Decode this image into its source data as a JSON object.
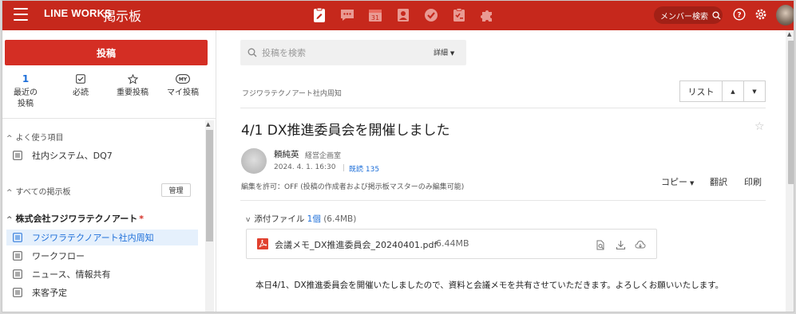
{
  "topbar": {
    "brand": "LINE WORKS",
    "app_name": "掲示板",
    "app_icons": [
      "board-icon",
      "chat-icon",
      "calendar-icon",
      "contacts-icon",
      "task-icon",
      "survey-icon",
      "puzzle-icon"
    ],
    "calendar_day": "31",
    "member_search": "メンバー検索",
    "accent": "#c6281c"
  },
  "sidebar": {
    "post_button": "投稿",
    "quick": [
      {
        "count": "1",
        "label": "最近の\n投稿"
      },
      {
        "label": "必読"
      },
      {
        "label": "重要投稿"
      },
      {
        "icon_text": "MY",
        "label": "マイ投稿"
      }
    ],
    "favorites_header": "よく使う項目",
    "favorites": [
      "社内システム、DQ7"
    ],
    "all_boards_header": "すべての掲示板",
    "manage_button": "管理",
    "company": "株式会社フジワラテクノアート",
    "company_mark": "*",
    "boards": [
      "フジワラテクノアート社内周知",
      "ワークフロー",
      "ニュース、情報共有",
      "来客予定"
    ],
    "active_board_color": "#1e6fd9"
  },
  "main": {
    "search_placeholder": "投稿を検索",
    "search_detail": "詳細",
    "breadcrumb": "フジワラテクノアート社内周知",
    "list_button": "リスト",
    "title": "4/1 DX推進委員会を開催しました",
    "author_name": "頼純英",
    "author_dept": "経営企画室",
    "date": "2024. 4. 1. 16:30",
    "read_label": "既読 135",
    "copy": "コピー",
    "translate": "翻訳",
    "print": "印刷",
    "permission": "編集を許可：OFF (投稿の作成者および掲示板マスターのみ編集可能)",
    "attachments_label": "添付ファイル",
    "attachments_count": "1個",
    "attachments_size": "(6.4MB)",
    "file_name": "会議メモ_DX推進委員会_20240401.pdf",
    "file_size": "6.44MB",
    "body": "本日4/1、DX推進委員会を開催いたしましたので、資料と会議メモを共有させていただきます。よろしくお願いいたします。"
  }
}
